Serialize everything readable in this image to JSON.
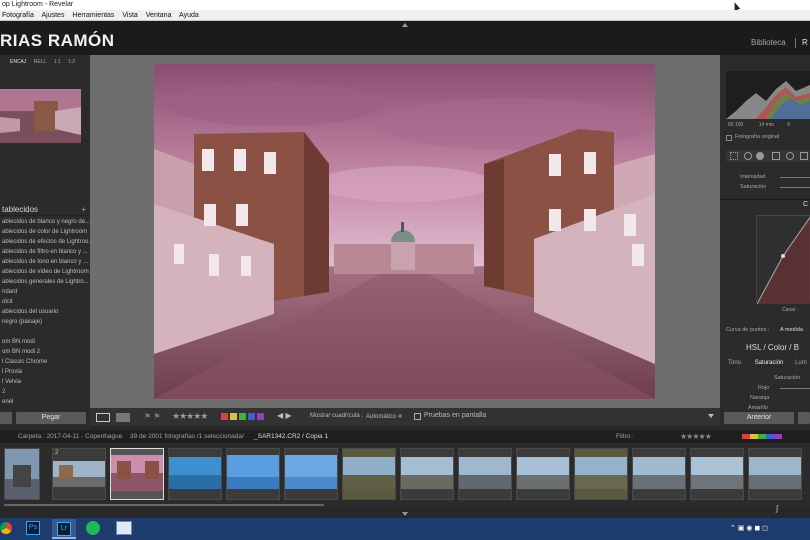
{
  "window": {
    "title": "op Lightroom - Revelar"
  },
  "menu": [
    "Fotografía",
    "Ajustes",
    "Herramientas",
    "Vista",
    "Ventana",
    "Ayuda"
  ],
  "identity": {
    "brand": "RIAS RAMÓN",
    "modules": [
      "Biblioteca",
      "R"
    ]
  },
  "navigator": {
    "options": [
      "ENCAJ",
      "RELL",
      "1:1",
      "1:2"
    ]
  },
  "presets": {
    "header": "tablecidos",
    "items": [
      "ablecidos de blanco y negro de...",
      "ablecidos de color de Lightroom",
      "ablecidos de efectos de Lightroo...",
      "ablecidos de filtro en blanco y ...",
      "ablecidos de tono en blanco y ...",
      "ablecidos de vídeo de Lightroom",
      "ablecidos generales de Lightro...",
      "ndard",
      "olcit",
      "ablecidos del usuario",
      "negro (paisaje)",
      "",
      "om BN modi",
      "om BN modi 2",
      "l Classic Chrome",
      "l Provia",
      "l Velvia",
      "2",
      "enel"
    ]
  },
  "left_buttons": {
    "paste": "Pegar"
  },
  "toolbar": {
    "grid_label": "Mostrar cuadrícula :",
    "grid_value": "Automático ≑",
    "proof": "Pruebas en pantalla"
  },
  "histogram": {
    "left": "60 100",
    "mid": "14 mm",
    "right": "f/",
    "original": "Fotografía original"
  },
  "right": {
    "intensity": "Intensidad",
    "saturation": "Saturación",
    "channel": "Canal :",
    "curve_label": "Curva de puntos :",
    "curve_value": "A medida",
    "hsl_title": "HSL / Color / B",
    "hsl_tabs": [
      "Tono",
      "Saturación",
      "Lum"
    ],
    "hsl_sub": "Saturación",
    "hsl_items": [
      "Rojo",
      "Naranja",
      "Amarillo"
    ],
    "prev_button": "Anterior",
    "sec_c": "C"
  },
  "infobar": {
    "folder": "Carpeta : 2017-04-11 - Copenhague",
    "count": "39 de 2001 fotografías /1 seleccionada/",
    "file": "_SAR1342.CR2 / Copia 1",
    "filter": "Filtro :"
  },
  "filmstrip": [
    {
      "label": ""
    },
    {
      "label": "2"
    },
    {
      "label": ""
    },
    {
      "label": ""
    },
    {
      "label": ""
    },
    {
      "label": ""
    },
    {
      "label": ""
    },
    {
      "label": ""
    },
    {
      "label": ""
    },
    {
      "label": ""
    },
    {
      "label": ""
    },
    {
      "label": ""
    },
    {
      "label": ""
    },
    {
      "label": ""
    }
  ],
  "taskbar": {
    "apps": [
      "chrome-icon",
      "photoshop-icon",
      "lightroom-icon",
      "spotify-icon",
      "app-icon"
    ]
  }
}
